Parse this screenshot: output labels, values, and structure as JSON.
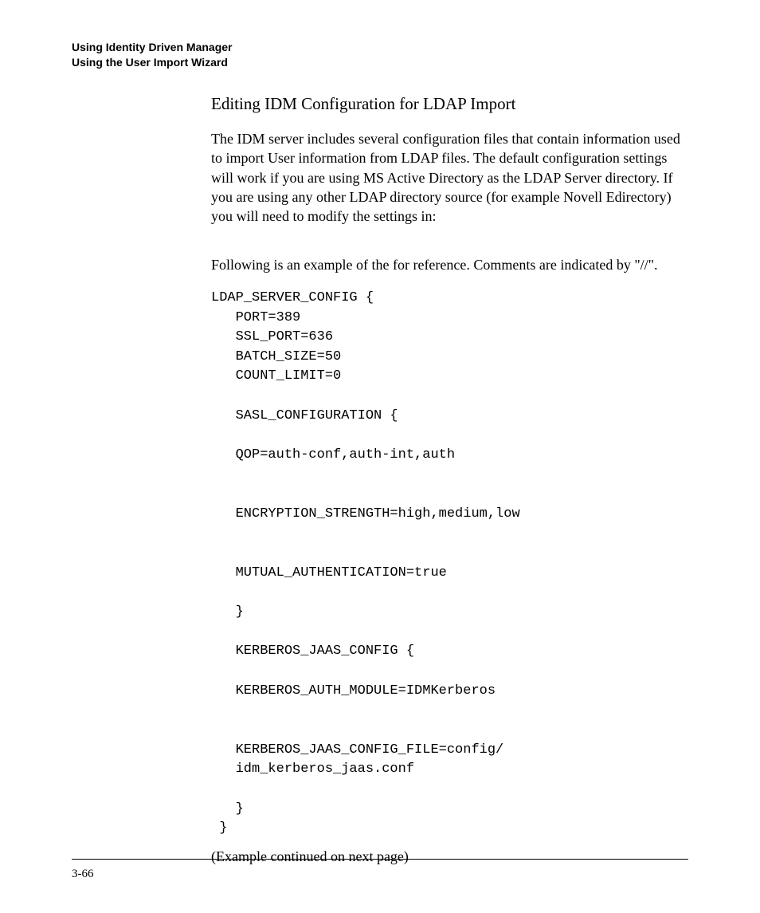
{
  "header": {
    "line1": "Using Identity Driven Manager",
    "line2": "Using the User Import Wizard"
  },
  "section_title": "Editing IDM Configuration for LDAP Import",
  "para1_a": "The IDM server includes several configuration files that contain information used to import User information from LDAP files. The default configuration settings will work if you are using MS Active Directory as the LDAP Server directory. If you are using any other LDAP directory source (for example Novell Edirectory) you will need to modify the ",
  "para1_b": " settings in:",
  "para2_a": "Following is an example of the ",
  "para2_b": " for reference. Comments are indicated by \"//\".",
  "code": "LDAP_SERVER_CONFIG {\n   PORT=389\n   SSL_PORT=636\n   BATCH_SIZE=50\n   COUNT_LIMIT=0\n\n   SASL_CONFIGURATION {\n\n   QOP=auth-conf,auth-int,auth\n\n\n   ENCRYPTION_STRENGTH=high,medium,low\n\n\n   MUTUAL_AUTHENTICATION=true\n\n   }\n\n   KERBEROS_JAAS_CONFIG {\n\n   KERBEROS_AUTH_MODULE=IDMKerberos\n\n\n   KERBEROS_JAAS_CONFIG_FILE=config/\n   idm_kerberos_jaas.conf\n\n   }\n }",
  "continued": "(Example continued on next page)",
  "page_number": "3-66"
}
